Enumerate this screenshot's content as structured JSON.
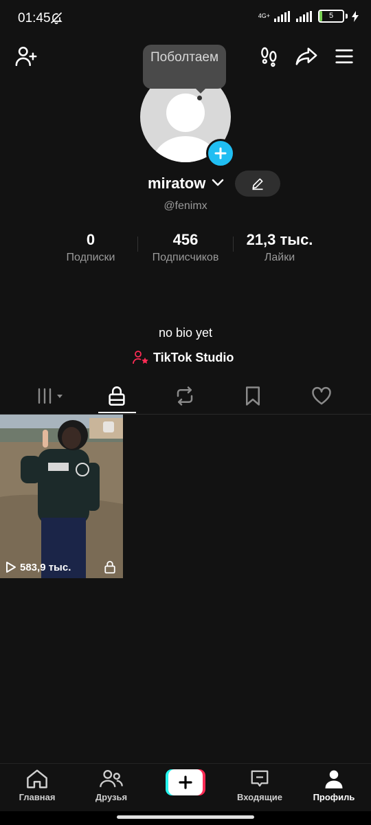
{
  "status_bar": {
    "time": "01:45",
    "network": "4G+",
    "battery": "5",
    "colors": {
      "battery_fill": "#7ad155"
    }
  },
  "header": {
    "icons": [
      "add-friend-icon",
      "footprints-icon",
      "share-icon",
      "menu-icon"
    ],
    "tooltip": "Поболтаем"
  },
  "profile": {
    "username": "miratow",
    "handle": "@fenimx",
    "bio": "no bio yet",
    "studio_link": "TikTok Studio",
    "colors": {
      "add_button": "#20bef2",
      "studio_icon": "#fe2c55"
    }
  },
  "stats": [
    {
      "value": "0",
      "label": "Подписки"
    },
    {
      "value": "456",
      "label": "Подписчиков"
    },
    {
      "value": "21,3 тыс.",
      "label": "Лайки"
    }
  ],
  "tabs": [
    {
      "name": "videos-grid-icon",
      "selected": false
    },
    {
      "name": "lock-icon",
      "selected": true
    },
    {
      "name": "repost-icon",
      "selected": false
    },
    {
      "name": "bookmark-icon",
      "selected": false
    },
    {
      "name": "heart-icon",
      "selected": false
    }
  ],
  "videos": [
    {
      "views": "583,9 тыс.",
      "private": true
    }
  ],
  "bottom_nav": {
    "items": [
      {
        "label": "Главная",
        "icon": "home-icon"
      },
      {
        "label": "Друзья",
        "icon": "friends-icon"
      },
      {
        "label": "",
        "icon": "create-icon"
      },
      {
        "label": "Входящие",
        "icon": "inbox-icon"
      },
      {
        "label": "Профиль",
        "icon": "profile-icon",
        "active": true
      }
    ],
    "colors": {
      "create_left": "#25f4ee",
      "create_right": "#fe2c55"
    }
  }
}
